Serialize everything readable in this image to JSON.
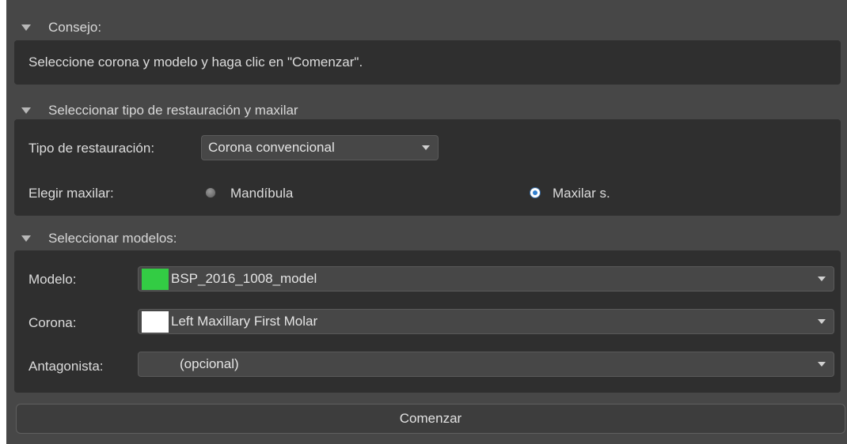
{
  "tip": {
    "header": "Consejo:",
    "text": "Seleccione corona y modelo y haga clic en \"Comenzar\"."
  },
  "restoration": {
    "header": "Seleccionar tipo de restauración y maxilar",
    "type_label": "Tipo de restauración:",
    "type_value": "Corona convencional",
    "jaw_label": "Elegir maxilar:",
    "jaw_options": [
      {
        "label": "Mandíbula",
        "selected": false
      },
      {
        "label": "Maxilar s.",
        "selected": true
      }
    ]
  },
  "models": {
    "header": "Seleccionar modelos:",
    "rows": [
      {
        "label": "Modelo:",
        "value": "BSP_2016_1008_model",
        "swatch": "#33cc44"
      },
      {
        "label": "Corona:",
        "value": "Left Maxillary First Molar",
        "swatch": "#ffffff"
      },
      {
        "label": "Antagonista:",
        "value": "(opcional)",
        "swatch": null
      }
    ]
  },
  "start_button": "Comenzar",
  "colors": {
    "background": "#474747",
    "panel": "#2f2f2f",
    "accent": "#2f7fd0"
  }
}
